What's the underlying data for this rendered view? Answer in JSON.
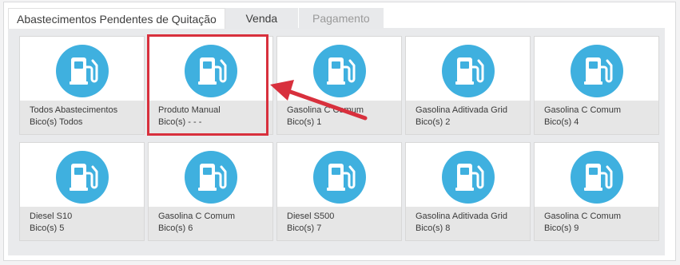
{
  "tabs": [
    {
      "label": "Abastecimentos Pendentes de Quitação",
      "state": "active"
    },
    {
      "label": "Venda",
      "state": "normal"
    },
    {
      "label": "Pagamento",
      "state": "disabled"
    }
  ],
  "icon": "fuel-pump-icon",
  "colors": {
    "accent": "#3fb0df",
    "highlight": "#d8303d"
  },
  "cards": [
    {
      "name": "Todos Abastecimentos",
      "bico": "Bico(s) Todos"
    },
    {
      "name": "Produto Manual",
      "bico": "Bico(s) - - -"
    },
    {
      "name": "Gasolina C Comum",
      "bico": "Bico(s) 1"
    },
    {
      "name": "Gasolina Aditivada Grid",
      "bico": "Bico(s) 2"
    },
    {
      "name": "Gasolina C Comum",
      "bico": "Bico(s) 4"
    },
    {
      "name": "Diesel S10",
      "bico": "Bico(s) 5"
    },
    {
      "name": "Gasolina C Comum",
      "bico": "Bico(s) 6"
    },
    {
      "name": "Diesel S500",
      "bico": "Bico(s) 7"
    },
    {
      "name": "Gasolina Aditivada Grid",
      "bico": "Bico(s) 8"
    },
    {
      "name": "Gasolina C Comum",
      "bico": "Bico(s) 9"
    }
  ]
}
